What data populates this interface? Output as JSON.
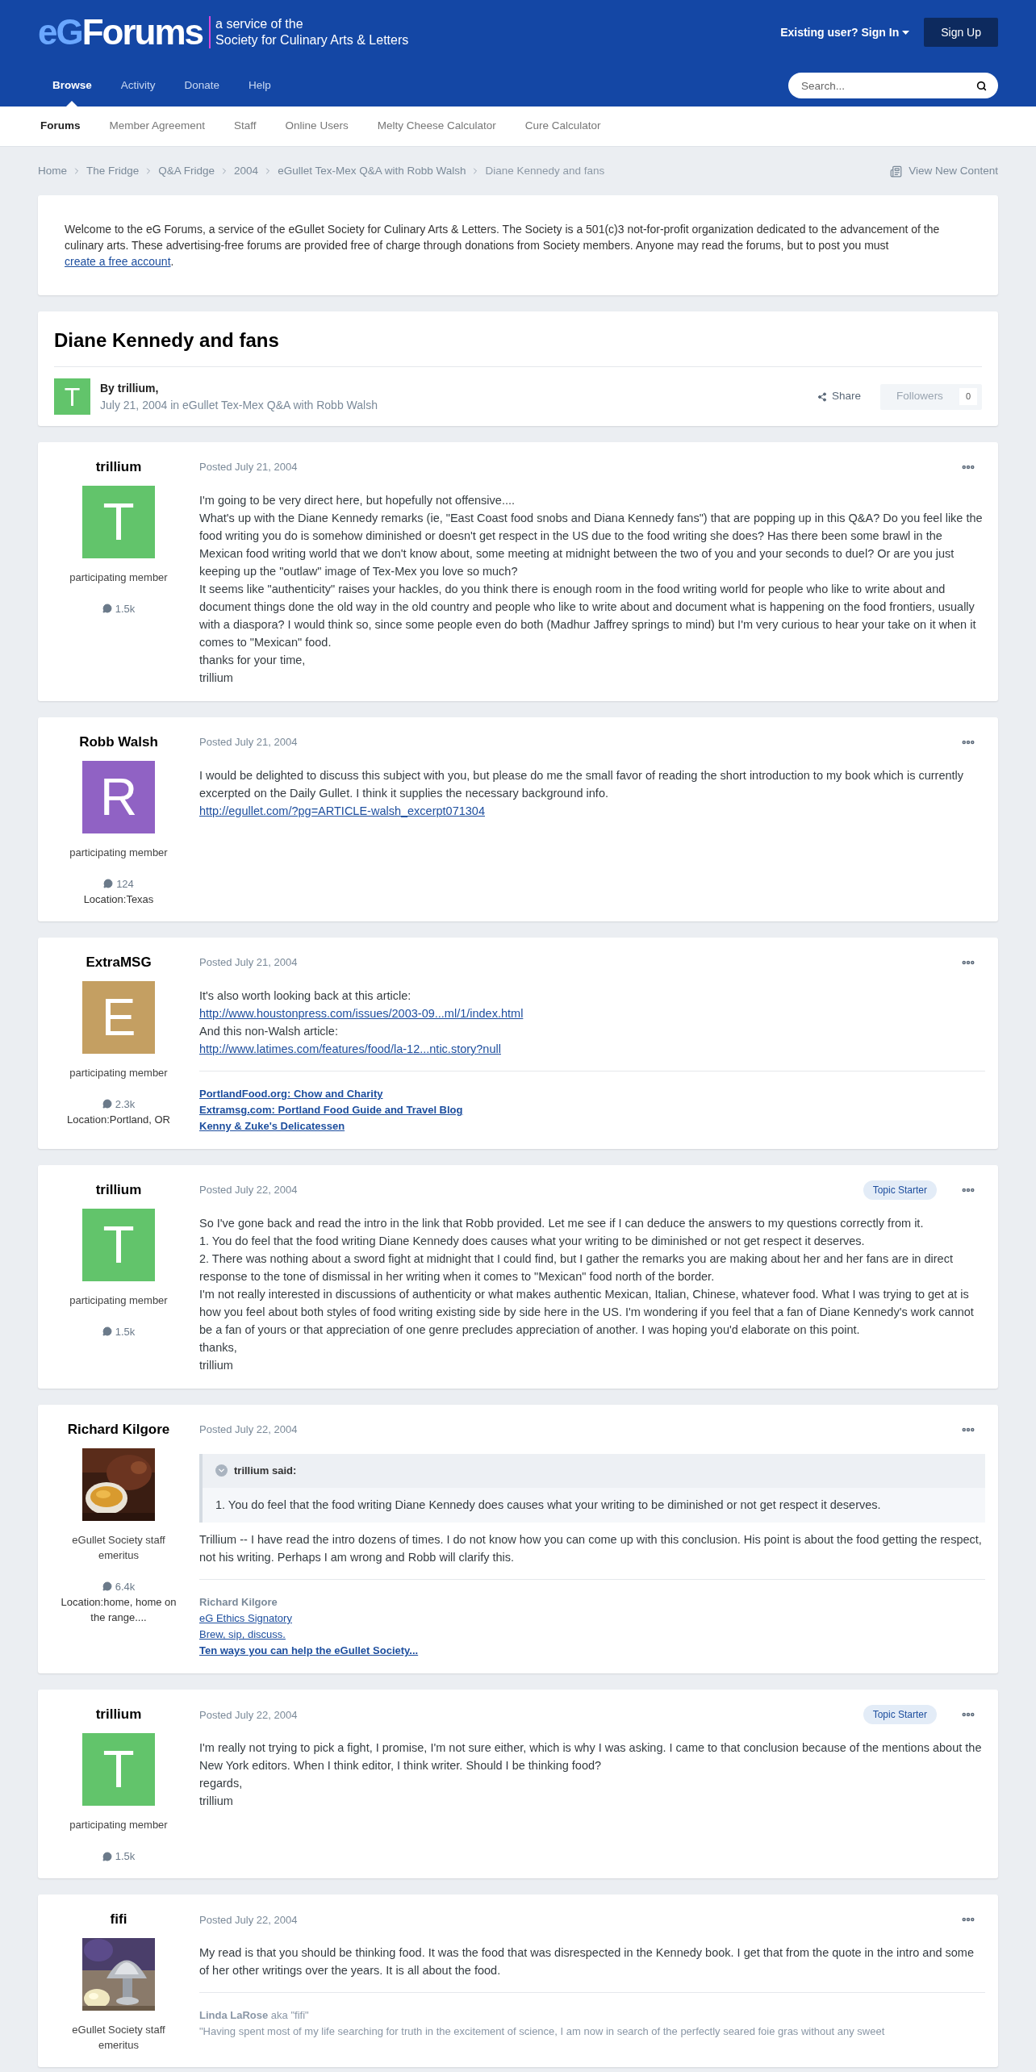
{
  "header": {
    "logo": {
      "prefix": "eG",
      "brand": "Forums",
      "tagline": [
        "a service of the",
        "Society for Culinary Arts & Letters"
      ]
    },
    "sign_in": "Existing user? Sign In",
    "sign_up": "Sign Up"
  },
  "nav": {
    "tabs": [
      {
        "label": "Browse",
        "selected": true
      },
      {
        "label": "Activity",
        "selected": false
      },
      {
        "label": "Donate",
        "selected": false
      },
      {
        "label": "Help",
        "selected": false
      }
    ],
    "search": {
      "placeholder": "Search..."
    }
  },
  "subnav": [
    {
      "label": "Forums",
      "selected": true
    },
    {
      "label": "Member Agreement",
      "selected": false
    },
    {
      "label": "Staff",
      "selected": false
    },
    {
      "label": "Online Users",
      "selected": false
    },
    {
      "label": "Melty Cheese Calculator",
      "selected": false
    },
    {
      "label": "Cure Calculator",
      "selected": false
    }
  ],
  "breadcrumb": {
    "items": [
      "Home",
      "The Fridge",
      "Q&A Fridge",
      "2004",
      "eGullet Tex-Mex Q&A with Robb Walsh"
    ],
    "current": "Diane Kennedy and fans",
    "view_new": "View New Content"
  },
  "welcome": {
    "text_before": "Welcome to the eG Forums, a service of the eGullet Society for Culinary Arts & Letters. The Society is a 501(c)3 not-for-profit organization dedicated to the advancement of the culinary arts. These advertising-free forums are provided free of charge through donations from Society members. Anyone may read the forums, but to post you must",
    "link": "create a free account",
    "text_after": "."
  },
  "topic": {
    "title": "Diane Kennedy and fans",
    "avatar": {
      "letter": "T",
      "color": "#62c46b"
    },
    "by": "By trillium,",
    "meta": "July 21, 2004 in eGullet Tex-Mex Q&A with Robb Walsh",
    "share": "Share",
    "followers": "Followers",
    "followers_count": "0"
  },
  "posts": [
    {
      "author": "trillium",
      "avatar": {
        "kind": "letter",
        "letter": "T",
        "color": "#62c46b"
      },
      "role": "participating member",
      "count": "1.5k",
      "date": "Posted July 21, 2004",
      "body": [
        {
          "kind": "text",
          "text": "I'm going to be very direct here, but hopefully not offensive...."
        },
        {
          "kind": "text",
          "text": "What's up with the Diane Kennedy remarks (ie, \"East Coast food snobs and Diana Kennedy fans\") that are popping up in this Q&A? Do you feel like the food writing you do is somehow diminished or doesn't get respect in the US due to the food writing she does? Has there been some brawl in the Mexican food writing world that we don't know about, some meeting at midnight between the two of you and your seconds to duel? Or are you just keeping up the \"outlaw\" image of Tex-Mex you love so much?"
        },
        {
          "kind": "text",
          "text": "It seems like \"authenticity\" raises your hackles, do you think there is enough room in the food writing world for people who like to write about and document things done the old way in the old country and people who like to write about and document what is happening on the food frontiers, usually with a diaspora? I would think so, since some people even do both (Madhur Jaffrey springs to mind) but I'm very curious to hear your take on it when it comes to \"Mexican\" food."
        },
        {
          "kind": "text",
          "text": "thanks for your time,"
        },
        {
          "kind": "text",
          "text": "trillium"
        }
      ]
    },
    {
      "author": "Robb Walsh",
      "avatar": {
        "kind": "letter",
        "letter": "R",
        "color": "#9062c4"
      },
      "role": "participating member",
      "count": "124",
      "location": "Location:Texas",
      "date": "Posted July 21, 2004",
      "body": [
        {
          "kind": "text",
          "text": "I would be delighted to discuss this subject with you, but please do me the small favor of reading the short introduction to my book which is currently excerpted on the Daily Gullet. I think it supplies the necessary background info."
        },
        {
          "kind": "link",
          "text": "http://egullet.com/?pg=ARTICLE-walsh_excerpt071304"
        }
      ]
    },
    {
      "author": "ExtraMSG",
      "avatar": {
        "kind": "letter",
        "letter": "E",
        "color": "#c49f62"
      },
      "role": "participating member",
      "count": "2.3k",
      "location": "Location:Portland, OR",
      "date": "Posted July 21, 2004",
      "body": [
        {
          "kind": "text",
          "text": "It's also worth looking back at this article:"
        },
        {
          "kind": "link",
          "text": "http://www.houstonpress.com/issues/2003-09...ml/1/index.html"
        },
        {
          "kind": "text",
          "text": "And this non-Walsh article:"
        },
        {
          "kind": "link",
          "text": "http://www.latimes.com/features/food/la-12...ntic.story?null"
        }
      ],
      "signature": [
        {
          "kind": "bold_link",
          "text": "PortlandFood.org: Chow and Charity"
        },
        {
          "kind": "bold_link",
          "text": "Extramsg.com: Portland Food Guide and Travel Blog"
        },
        {
          "kind": "bold_link",
          "text": "Kenny & Zuke's Delicatessen"
        }
      ]
    },
    {
      "author": "trillium",
      "avatar": {
        "kind": "letter",
        "letter": "T",
        "color": "#62c46b"
      },
      "role": "participating member",
      "count": "1.5k",
      "date": "Posted July 22, 2004",
      "badge": "Topic Starter",
      "body": [
        {
          "kind": "text",
          "text": "So I've gone back and read the intro in the link that Robb provided. Let me see if I can deduce the answers to my questions correctly from it."
        },
        {
          "kind": "text",
          "text": "1. You do feel that the food writing Diane Kennedy does causes what your writing to be diminished or not get respect it deserves."
        },
        {
          "kind": "text",
          "text": "2. There was nothing about a sword fight at midnight that I could find, but I gather the remarks you are making about her and her fans are in direct response to the tone of dismissal in her writing when it comes to \"Mexican\" food north of the border."
        },
        {
          "kind": "text",
          "text": "I'm not really interested in discussions of authenticity or what makes authentic Mexican, Italian, Chinese, whatever food. What I was trying to get at is how you feel about both styles of food writing existing side by side here in the US. I'm wondering if you feel that a fan of Diane Kennedy's work cannot be a fan of yours or that appreciation of one genre precludes appreciation of another. I was hoping you'd elaborate on this point."
        },
        {
          "kind": "text",
          "text": "thanks,"
        },
        {
          "kind": "text",
          "text": "trillium"
        }
      ]
    },
    {
      "author": "Richard Kilgore",
      "avatar": {
        "kind": "picture"
      },
      "role": "eGullet Society staff emeritus",
      "count": "6.4k",
      "location": "Location:home, home on the range....",
      "date": "Posted July 22, 2004",
      "quote": {
        "author": "trillium said:",
        "text": "1. You do feel that the food writing Diane Kennedy does causes what your writing to be diminished or not get respect it deserves."
      },
      "body": [
        {
          "kind": "text",
          "text": "Trillium -- I have read the intro dozens of times. I do not know how you can come up with this conclusion. His point is about the food getting the respect, not his writing. Perhaps I am wrong and Robb will clarify this."
        }
      ],
      "signature": [
        {
          "kind": "label",
          "text": "Richard Kilgore"
        },
        {
          "kind": "link",
          "text": "eG Ethics Signatory"
        },
        {
          "kind": "link",
          "text": "Brew, sip, discuss."
        },
        {
          "kind": "bold_link",
          "text": "Ten ways you can help the eGullet Society..."
        }
      ]
    },
    {
      "author": "trillium",
      "avatar": {
        "kind": "letter",
        "letter": "T",
        "color": "#62c46b"
      },
      "role": "participating member",
      "count": "1.5k",
      "date": "Posted July 22, 2004",
      "badge": "Topic Starter",
      "body": [
        {
          "kind": "text",
          "text": "I'm really not trying to pick a fight, I promise, I'm not sure either, which is why I was asking. I came to that conclusion because of the mentions about the New York editors. When I think editor, I think writer. Should I be thinking food?"
        },
        {
          "kind": "text",
          "text": "regards,"
        },
        {
          "kind": "text",
          "text": "trillium"
        }
      ]
    },
    {
      "author": "fifi",
      "avatar": {
        "kind": "picture"
      },
      "role": "eGullet Society staff emeritus",
      "date": "Posted July 22, 2004",
      "body": [
        {
          "kind": "text",
          "text": "My read is that you should be thinking food. It was the food that was disrespected in the Kennedy book. I get that from the quote in the intro and some of her other writings over the years. It is all about the food."
        }
      ],
      "signature": [
        {
          "kind": "rich",
          "text": "**Linda LaRose** aka \"fifi\""
        },
        {
          "kind": "quote",
          "text": "\"Having spent most of my life searching for truth in the excitement of science, I am now in search of the perfectly seared foie gras without any sweet"
        }
      ]
    }
  ]
}
